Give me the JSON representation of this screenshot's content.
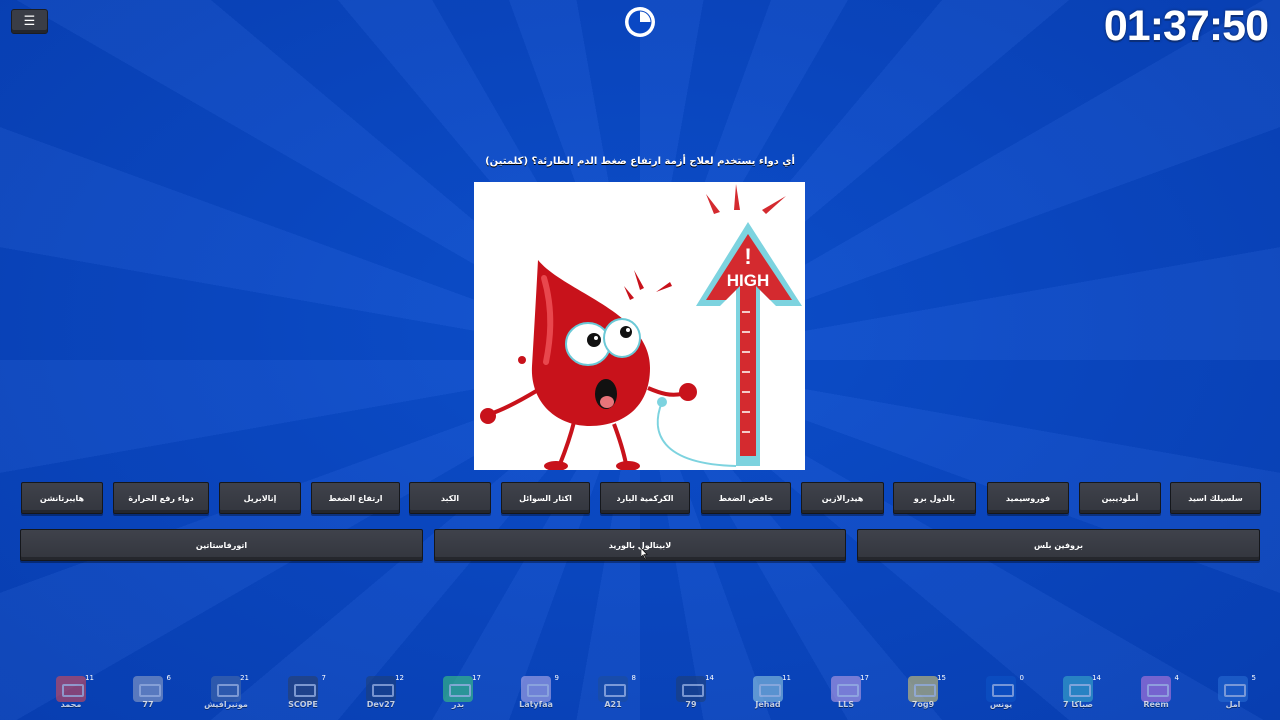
{
  "header": {
    "menu_icon": "hamburger-icon",
    "clock_icon": "clock-icon",
    "timer": "01:37:50"
  },
  "question": {
    "text": "أي دواء يستخدم لعلاج أزمة ارتفاع ضغط الدم الطارئة؟ (كلمتين)",
    "image_sign_text": "HIGH",
    "image_sign_mark": "!"
  },
  "answers": [
    "سلسيلك اسيد",
    "أملوديبين",
    "فوروسيميد",
    "بالدول برو",
    "هيدرالازين",
    "خافض الضغط",
    "الكركمية البارد",
    "اكثار السوائل",
    "الكبد",
    "ارتفاع الضغط",
    "إنالابريل",
    "دواء رفع الحرارة",
    "هايبرتانشن"
  ],
  "wide_answers": [
    "بروفين بلس",
    "لابيتالول بالوريد",
    "اتورفاستاتين"
  ],
  "players": [
    {
      "name": "امل",
      "score": "5",
      "color": "#2a6fd6"
    },
    {
      "name": "Reem",
      "score": "4",
      "color": "#c77be0"
    },
    {
      "name": "صباكا 7",
      "score": "14",
      "color": "#3bb0c9"
    },
    {
      "name": "يونس",
      "score": "0",
      "color": "#0e55c8"
    },
    {
      "name": "7og9",
      "score": "15",
      "color": "#e7d26a"
    },
    {
      "name": "LLS",
      "score": "17",
      "color": "#c8a4e8"
    },
    {
      "name": "Jehad",
      "score": "11",
      "color": "#9bd4e4"
    },
    {
      "name": "79",
      "score": "14",
      "color": "#1f3f73"
    },
    {
      "name": "A21",
      "score": "8",
      "color": "#1e4c9a"
    },
    {
      "name": "Latyfaa",
      "score": "9",
      "color": "#c4b6f0"
    },
    {
      "name": "بدر",
      "score": "17",
      "color": "#3ed27a"
    },
    {
      "name": "Dev27",
      "score": "12",
      "color": "#1f3f73"
    },
    {
      "name": "SCOPE",
      "score": "7",
      "color": "#2a3e63"
    },
    {
      "name": "مونيرافيش",
      "score": "21",
      "color": "#4b6ea8"
    },
    {
      "name": "77",
      "score": "6",
      "color": "#9aa8c8"
    },
    {
      "name": "محمد",
      "score": "11",
      "color": "#e5484d"
    }
  ]
}
